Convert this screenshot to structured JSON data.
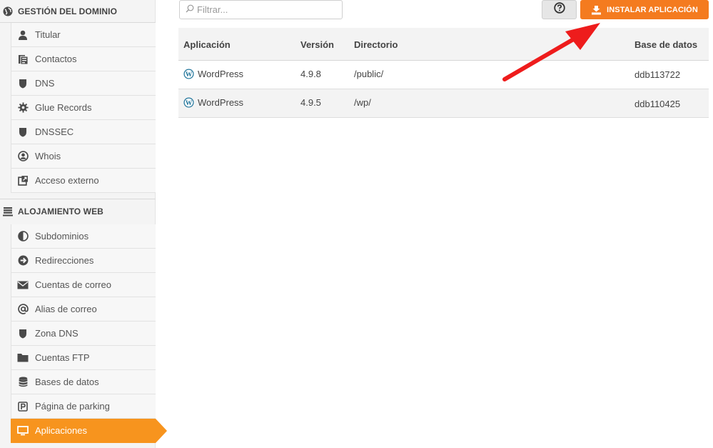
{
  "sidebar": {
    "section_domain": {
      "title": "GESTIÓN DEL DOMINIO",
      "icon": "globe-icon"
    },
    "domain_items": [
      {
        "label": "Titular",
        "icon": "user-icon"
      },
      {
        "label": "Contactos",
        "icon": "address-book-icon"
      },
      {
        "label": "DNS",
        "icon": "shield-icon"
      },
      {
        "label": "Glue Records",
        "icon": "gear-icon"
      },
      {
        "label": "DNSSEC",
        "icon": "shield-icon"
      },
      {
        "label": "Whois",
        "icon": "user-circle-icon"
      },
      {
        "label": "Acceso externo",
        "icon": "external-link-icon"
      }
    ],
    "section_hosting": {
      "title": "ALOJAMIENTO WEB",
      "icon": "server-icon"
    },
    "hosting_items": [
      {
        "label": "Subdominios",
        "icon": "half-circle-icon"
      },
      {
        "label": "Redirecciones",
        "icon": "arrow-circle-icon"
      },
      {
        "label": "Cuentas de correo",
        "icon": "envelope-icon"
      },
      {
        "label": "Alias de correo",
        "icon": "at-icon"
      },
      {
        "label": "Zona DNS",
        "icon": "shield-icon"
      },
      {
        "label": "Cuentas FTP",
        "icon": "folder-icon"
      },
      {
        "label": "Bases de datos",
        "icon": "database-icon"
      },
      {
        "label": "Página de parking",
        "icon": "parking-icon"
      },
      {
        "label": "Aplicaciones",
        "icon": "monitor-icon",
        "active": true
      }
    ]
  },
  "toolbar": {
    "filter_placeholder": "Filtrar...",
    "filter_value": "",
    "help_icon": "question-circle-icon",
    "install_label": "INSTALAR APLICACIÓN",
    "install_icon": "install-icon"
  },
  "table": {
    "headers": [
      "Aplicación",
      "Versión",
      "Directorio",
      "Base de datos"
    ],
    "rows": [
      {
        "app": "WordPress",
        "version": "4.9.8",
        "directory": "/public/",
        "database": "ddb113722"
      },
      {
        "app": "WordPress",
        "version": "4.9.5",
        "directory": "/wp/",
        "database": "ddb110425"
      }
    ]
  },
  "colors": {
    "accent": "#f7941e",
    "install_button": "#f47b1f",
    "annotation_arrow": "#ee1c1c",
    "icon": "#4a4a4a"
  }
}
